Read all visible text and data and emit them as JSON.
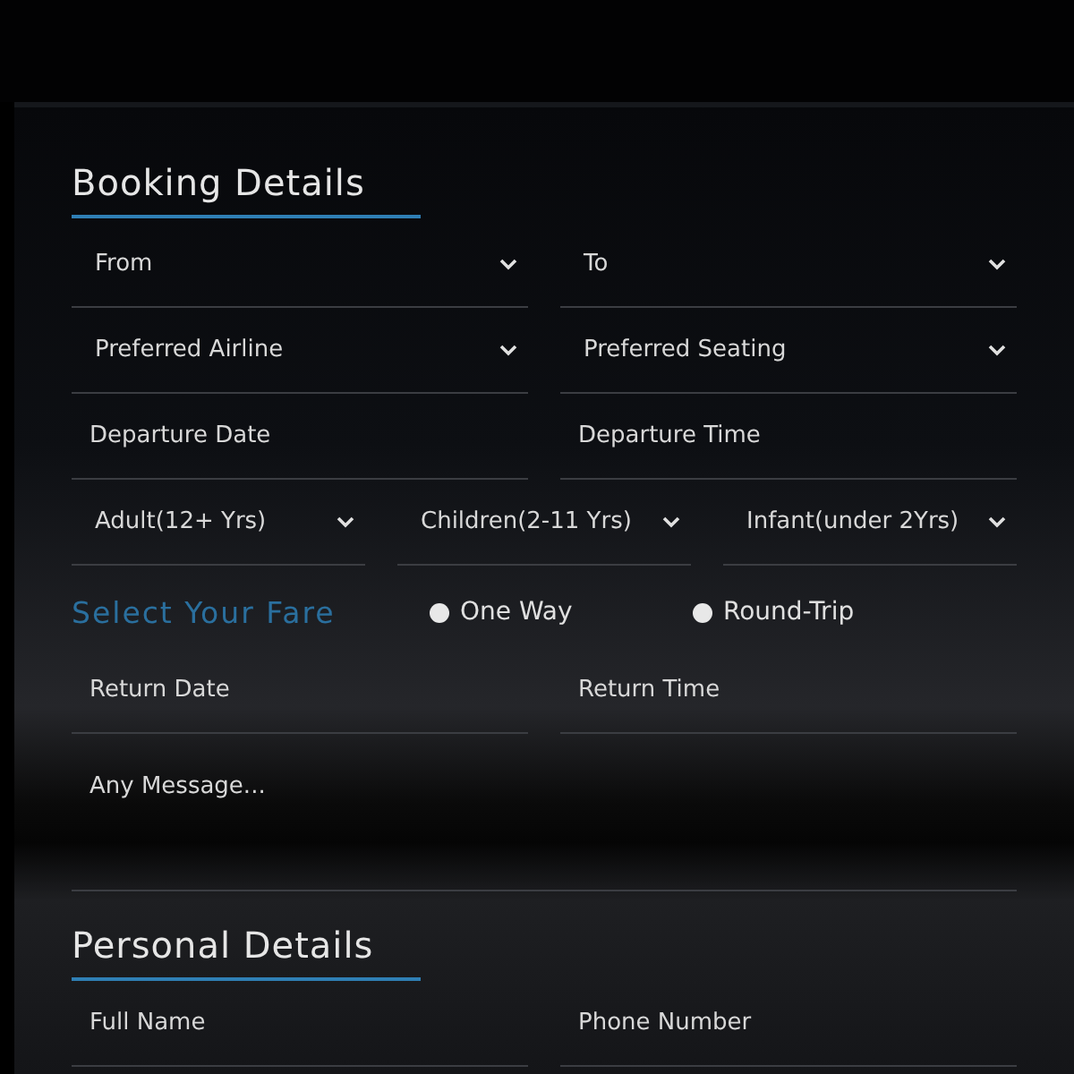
{
  "booking": {
    "title": "Booking Details",
    "rows": [
      [
        {
          "kind": "select",
          "placeholder": "From"
        },
        {
          "kind": "select",
          "placeholder": "To"
        }
      ],
      [
        {
          "kind": "select",
          "placeholder": "Preferred Airline"
        },
        {
          "kind": "select",
          "placeholder": "Preferred Seating"
        }
      ],
      [
        {
          "kind": "input",
          "placeholder": "Departure Date"
        },
        {
          "kind": "input",
          "placeholder": "Departure Time"
        }
      ],
      [
        {
          "kind": "select",
          "placeholder": "Adult(12+ Yrs)"
        },
        {
          "kind": "select",
          "placeholder": "Children(2-11 Yrs)"
        },
        {
          "kind": "select",
          "placeholder": "Infant(under 2Yrs)"
        }
      ]
    ]
  },
  "fare": {
    "title": "Select Your Fare",
    "options": [
      {
        "label": "One Way",
        "selected": false
      },
      {
        "label": "Round-Trip",
        "selected": false
      }
    ],
    "rows": [
      [
        {
          "kind": "input",
          "placeholder": "Return Date"
        },
        {
          "kind": "input",
          "placeholder": "Return Time"
        }
      ]
    ],
    "message": {
      "placeholder": "Any Message..."
    }
  },
  "personal": {
    "title": "Personal Details",
    "rows": [
      [
        {
          "kind": "input",
          "placeholder": "Full Name"
        },
        {
          "kind": "input",
          "placeholder": "Phone Number"
        }
      ]
    ]
  }
}
